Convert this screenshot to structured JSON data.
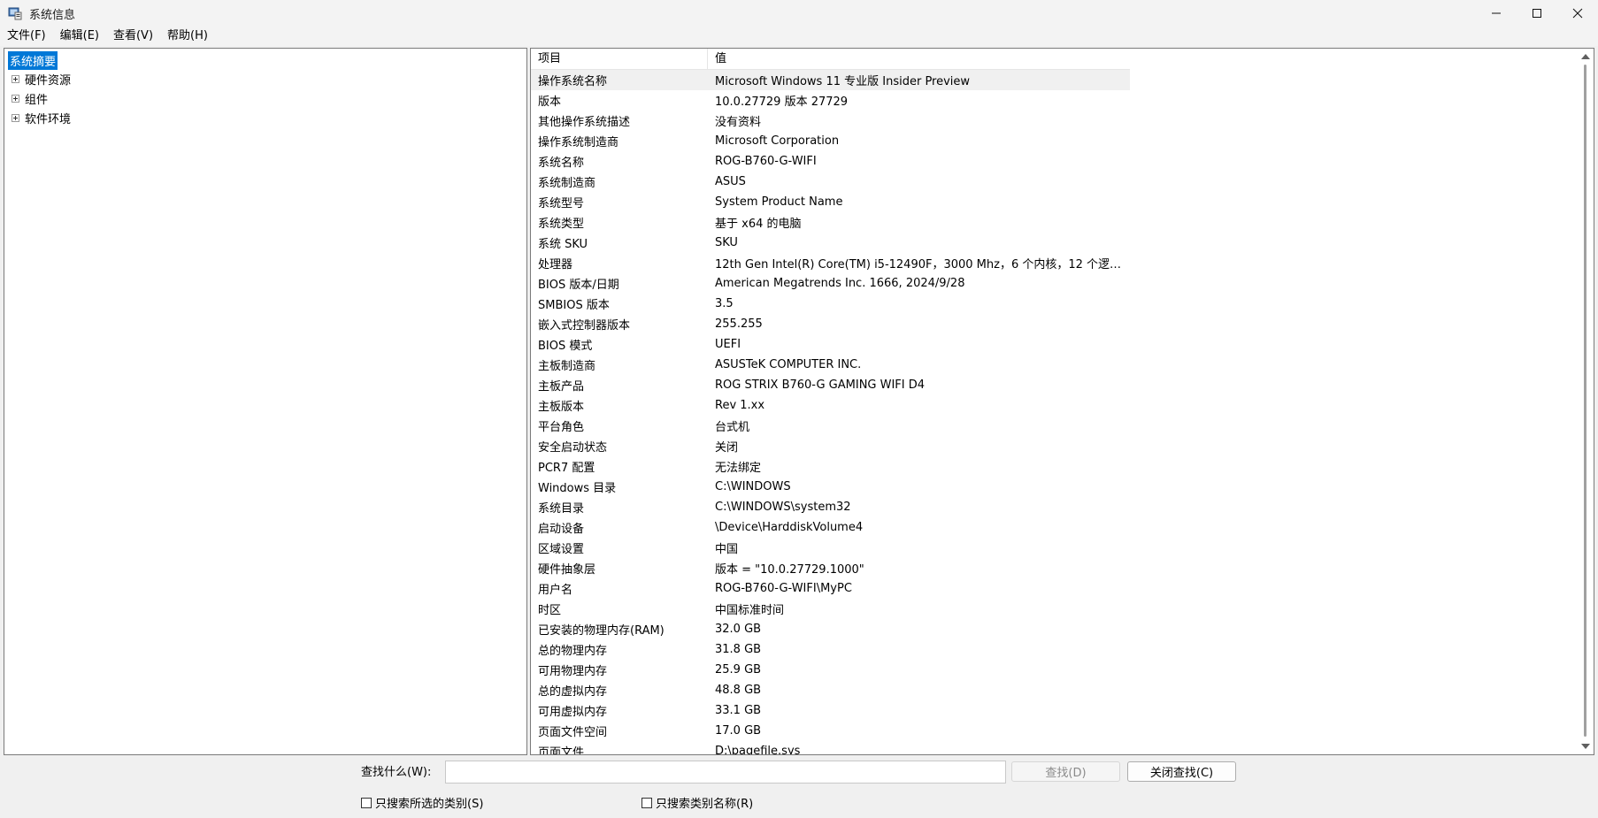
{
  "window": {
    "title": "系统信息",
    "minimize_icon": "minimize-icon",
    "maximize_icon": "maximize-icon",
    "close_icon": "close-icon"
  },
  "menu": [
    "文件(F)",
    "编辑(E)",
    "查看(V)",
    "帮助(H)"
  ],
  "tree": {
    "root": "系统摘要",
    "children": [
      "硬件资源",
      "组件",
      "软件环境"
    ]
  },
  "list": {
    "headers": {
      "item": "项目",
      "value": "值"
    },
    "rows": [
      {
        "item": "操作系统名称",
        "value": "Microsoft Windows 11 专业版 Insider Preview"
      },
      {
        "item": "版本",
        "value": "10.0.27729 版本 27729"
      },
      {
        "item": "其他操作系统描述",
        "value": "没有资料"
      },
      {
        "item": "操作系统制造商",
        "value": "Microsoft Corporation"
      },
      {
        "item": "系统名称",
        "value": "ROG-B760-G-WIFI"
      },
      {
        "item": "系统制造商",
        "value": "ASUS"
      },
      {
        "item": "系统型号",
        "value": "System Product Name"
      },
      {
        "item": "系统类型",
        "value": "基于 x64 的电脑"
      },
      {
        "item": "系统 SKU",
        "value": "SKU"
      },
      {
        "item": "处理器",
        "value": "12th Gen Intel(R) Core(TM) i5-12490F，3000 Mhz，6 个内核，12 个逻辑..."
      },
      {
        "item": "BIOS 版本/日期",
        "value": "American Megatrends Inc. 1666, 2024/9/28"
      },
      {
        "item": "SMBIOS 版本",
        "value": "3.5"
      },
      {
        "item": "嵌入式控制器版本",
        "value": "255.255"
      },
      {
        "item": "BIOS 模式",
        "value": "UEFI"
      },
      {
        "item": "主板制造商",
        "value": "ASUSTeK COMPUTER INC."
      },
      {
        "item": "主板产品",
        "value": "ROG STRIX B760-G GAMING WIFI D4"
      },
      {
        "item": "主板版本",
        "value": "Rev 1.xx"
      },
      {
        "item": "平台角色",
        "value": "台式机"
      },
      {
        "item": "安全启动状态",
        "value": "关闭"
      },
      {
        "item": "PCR7 配置",
        "value": "无法绑定"
      },
      {
        "item": "Windows 目录",
        "value": "C:\\WINDOWS"
      },
      {
        "item": "系统目录",
        "value": "C:\\WINDOWS\\system32"
      },
      {
        "item": "启动设备",
        "value": "\\Device\\HarddiskVolume4"
      },
      {
        "item": "区域设置",
        "value": "中国"
      },
      {
        "item": "硬件抽象层",
        "value": "版本 = \"10.0.27729.1000\""
      },
      {
        "item": "用户名",
        "value": "ROG-B760-G-WIFI\\MyPC"
      },
      {
        "item": "时区",
        "value": "中国标准时间"
      },
      {
        "item": "已安装的物理内存(RAM)",
        "value": "32.0 GB"
      },
      {
        "item": "总的物理内存",
        "value": "31.8 GB"
      },
      {
        "item": "可用物理内存",
        "value": "25.9 GB"
      },
      {
        "item": "总的虚拟内存",
        "value": "48.8 GB"
      },
      {
        "item": "可用虚拟内存",
        "value": "33.1 GB"
      },
      {
        "item": "页面文件空间",
        "value": "17.0 GB"
      },
      {
        "item": "页面文件",
        "value": "D:\\pagefile.sys"
      }
    ]
  },
  "find": {
    "label": "查找什么(W):",
    "input_value": "",
    "find_button": "查找(D)",
    "close_button": "关闭查找(C)",
    "checkbox_selected": "只搜索所选的类别(S)",
    "checkbox_names": "只搜索类别名称(R)"
  },
  "colors": {
    "selection": "#0078d7",
    "highlight_row": "#f0f0f0"
  }
}
